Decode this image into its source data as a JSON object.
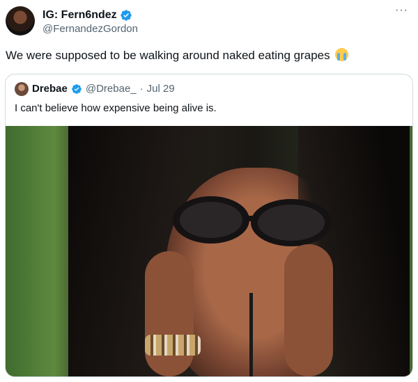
{
  "tweet": {
    "author_name": "IG: Fern6ndez",
    "author_handle": "@FernandezGordon",
    "more_icon": "more-icon",
    "text": "We were supposed to be walking around naked eating grapes",
    "text_emoji": "loudly-crying-face-emoji"
  },
  "quote": {
    "author_name": "Drebae",
    "author_handle": "@Drebae_",
    "separator": "·",
    "date": "Jul 29",
    "text": "I can't believe how expensive being alive is.",
    "media": "photo-woman-sunglasses-hands-on-face"
  },
  "colors": {
    "verified": "#1d9bf0",
    "secondary_text": "#536471",
    "border": "#cfd9de"
  }
}
